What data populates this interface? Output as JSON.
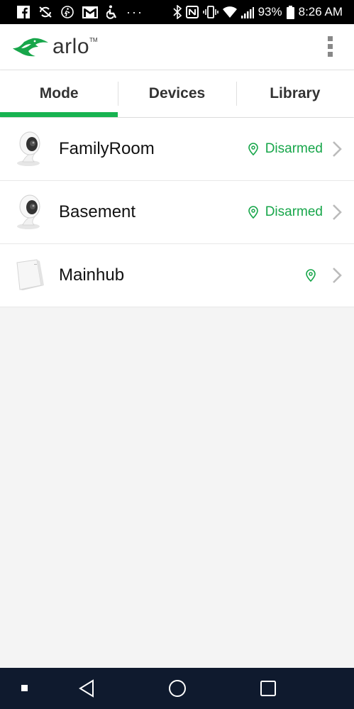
{
  "status_bar": {
    "battery": "93%",
    "time": "8:26 AM",
    "overflow": "···",
    "icons_left": [
      "facebook-icon",
      "sync-off-icon",
      "activity-icon",
      "gmail-icon",
      "accessibility-icon"
    ],
    "icons_right": [
      "bluetooth-icon",
      "nfc-icon",
      "vibrate-icon",
      "wifi-icon",
      "signal-icon",
      "battery-icon"
    ]
  },
  "header": {
    "brand": "arlo",
    "tm": "TM",
    "menu_icon": "more-vert-icon"
  },
  "tabs": [
    {
      "label": "Mode",
      "active": true
    },
    {
      "label": "Devices",
      "active": false
    },
    {
      "label": "Library",
      "active": false
    }
  ],
  "devices": [
    {
      "name": "FamilyRoom",
      "status": "Disarmed",
      "kind": "camera"
    },
    {
      "name": "Basement",
      "status": "Disarmed",
      "kind": "camera"
    },
    {
      "name": "Mainhub",
      "status": "",
      "kind": "hub"
    }
  ],
  "colors": {
    "accent": "#17b350",
    "status_green": "#17a64a",
    "nav_bar": "#0f1a2e"
  },
  "nav_bar": {
    "buttons": [
      "recents-dot-icon",
      "back-icon",
      "home-icon",
      "overview-icon"
    ]
  }
}
